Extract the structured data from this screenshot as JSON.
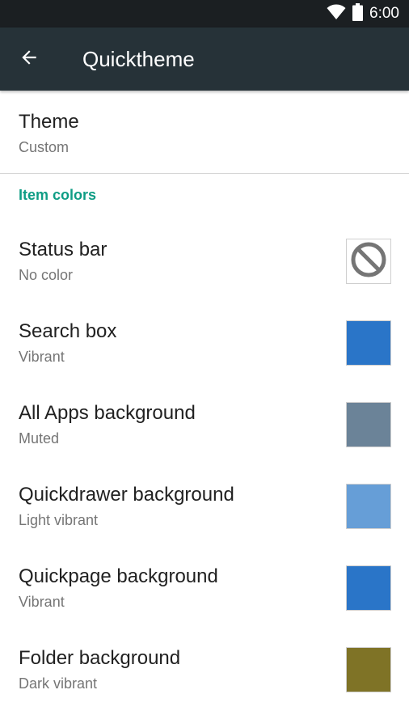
{
  "status_bar": {
    "time": "6:00",
    "wifi_icon": "wifi-icon",
    "battery_icon": "battery-icon"
  },
  "toolbar": {
    "title": "Quicktheme",
    "back_icon": "arrow-back-icon"
  },
  "theme": {
    "title": "Theme",
    "value": "Custom"
  },
  "section": {
    "header": "Item colors"
  },
  "items": [
    {
      "title": "Status bar",
      "subtitle": "No color",
      "color": "none",
      "icon": "no-color-icon"
    },
    {
      "title": "Search box",
      "subtitle": "Vibrant",
      "color": "#2a75c8"
    },
    {
      "title": "All Apps background",
      "subtitle": "Muted",
      "color": "#6b8398"
    },
    {
      "title": "Quickdrawer background",
      "subtitle": "Light vibrant",
      "color": "#669ed7"
    },
    {
      "title": "Quickpage background",
      "subtitle": "Vibrant",
      "color": "#2a75c8"
    },
    {
      "title": "Folder background",
      "subtitle": "Dark vibrant",
      "color": "#7f7326"
    }
  ]
}
